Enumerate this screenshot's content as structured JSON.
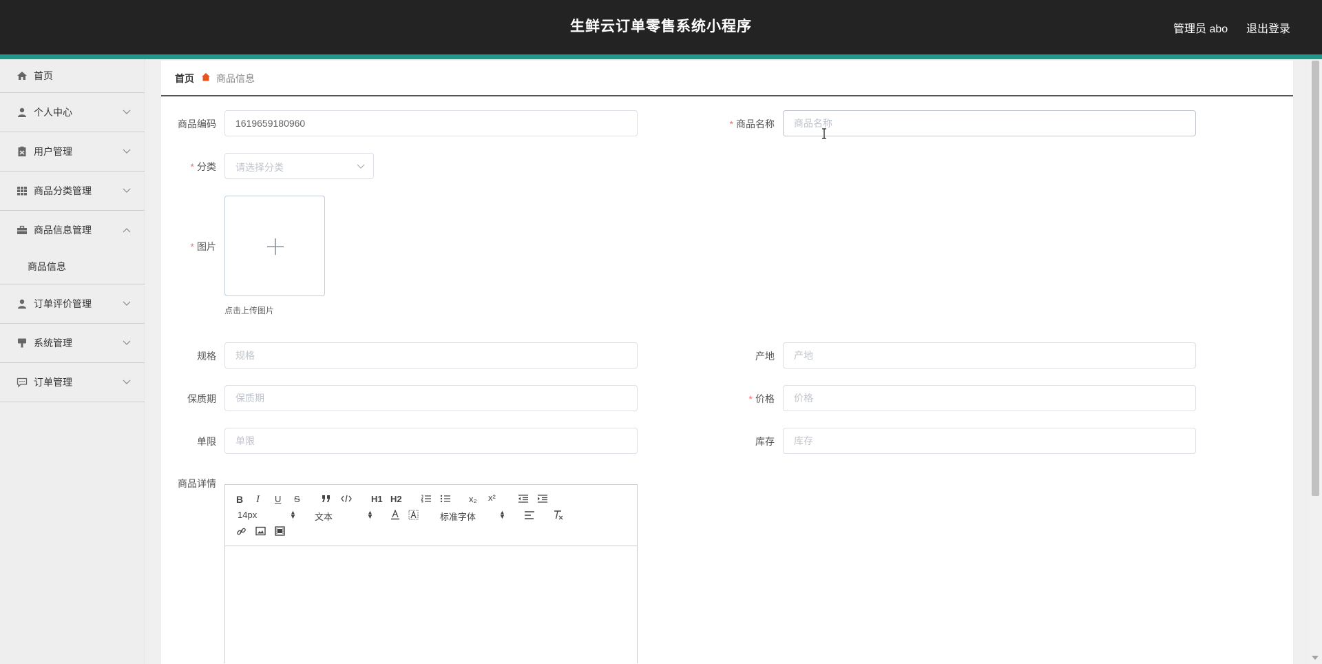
{
  "header": {
    "title": "生鲜云订单零售系统小程序",
    "user_label": "管理员 abo",
    "logout_label": "退出登录"
  },
  "sidebar": {
    "items": [
      {
        "label": "首页",
        "icon": "home-icon"
      },
      {
        "label": "个人中心",
        "icon": "person-icon"
      },
      {
        "label": "用户管理",
        "icon": "clipboard-icon"
      },
      {
        "label": "商品分类管理",
        "icon": "grid-icon"
      },
      {
        "label": "商品信息管理",
        "icon": "briefcase-icon",
        "sub": [
          "商品信息"
        ]
      },
      {
        "label": "订单评价管理",
        "icon": "person-icon"
      },
      {
        "label": "系统管理",
        "icon": "brush-icon"
      },
      {
        "label": "订单管理",
        "icon": "chat-icon"
      }
    ]
  },
  "breadcrumb": {
    "home": "首页",
    "current": "商品信息"
  },
  "form": {
    "code": {
      "label": "商品编码",
      "value": "1619659180960"
    },
    "name": {
      "label": "商品名称",
      "placeholder": "商品名称",
      "required_mark": "*"
    },
    "category": {
      "label": "分类",
      "placeholder": "请选择分类",
      "required_mark": "*"
    },
    "image": {
      "label": "图片",
      "tip": "点击上传图片",
      "required_mark": "*"
    },
    "spec": {
      "label": "规格",
      "placeholder": "规格"
    },
    "origin": {
      "label": "产地",
      "placeholder": "产地"
    },
    "shelf_life": {
      "label": "保质期",
      "placeholder": "保质期"
    },
    "price": {
      "label": "价格",
      "placeholder": "价格",
      "required_mark": "*"
    },
    "limit": {
      "label": "单限",
      "placeholder": "单限"
    },
    "stock": {
      "label": "库存",
      "placeholder": "库存"
    },
    "detail": {
      "label": "商品详情"
    }
  },
  "editor": {
    "bold": "B",
    "italic": "I",
    "underline": "U",
    "strike": "S",
    "h1": "H1",
    "h2": "H2",
    "sub": "x₂",
    "sup": "x²",
    "size": "14px",
    "style": "文本",
    "font": "标准字体"
  },
  "colors": {
    "header_bg": "#232323",
    "accent": "#1d9a8c",
    "required": "#f56c6c",
    "breadcrumb_icon": "#e8541e"
  }
}
